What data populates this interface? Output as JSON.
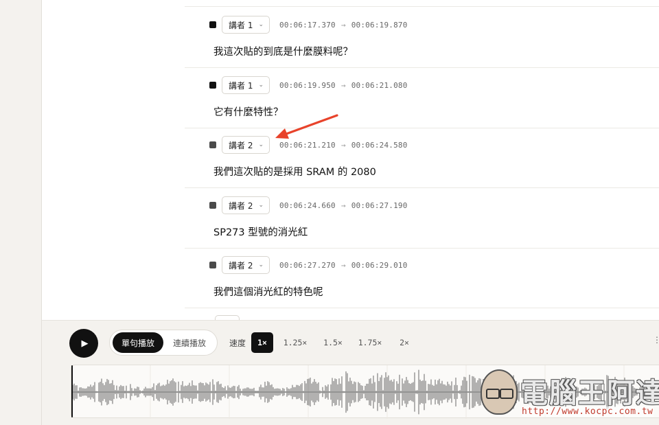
{
  "segments": [
    {
      "speaker": "講者 1",
      "start": "00:06:17.370",
      "arrow": "→",
      "end": "00:06:19.870",
      "text": "我這次貼的到底是什麼膜料呢？",
      "color": "#111111"
    },
    {
      "speaker": "講者 1",
      "start": "00:06:19.950",
      "arrow": "→",
      "end": "00:06:21.080",
      "text": "它有什麼特性？",
      "color": "#111111"
    },
    {
      "speaker": "講者 2",
      "start": "00:06:21.210",
      "arrow": "→",
      "end": "00:06:24.580",
      "text": "我們這次貼的是採用 SRAM 的 2080",
      "color": "#4a4a4a"
    },
    {
      "speaker": "講者 2",
      "start": "00:06:24.660",
      "arrow": "→",
      "end": "00:06:27.190",
      "text": "SP273 型號的消光紅",
      "color": "#4a4a4a"
    },
    {
      "speaker": "講者 2",
      "start": "00:06:27.270",
      "arrow": "→",
      "end": "00:06:29.010",
      "text": "我們這個消光紅的特色呢",
      "color": "#4a4a4a"
    }
  ],
  "player": {
    "play_icon": "play-icon",
    "mode_active": "單句播放",
    "mode_inactive": "連續播放",
    "speed_label": "速度",
    "speeds": [
      "1×",
      "1.25×",
      "1.5×",
      "1.75×",
      "2×"
    ],
    "active_speed": "1×",
    "more_icon": "more-icon",
    "playhead_fraction": 0
  },
  "annotation": {
    "arrow_color": "#e8432b"
  },
  "watermark": {
    "title": "電腦王阿達",
    "url": "http://www.kocpc.com.tw"
  },
  "colors": {
    "accent": "#111111",
    "background": "#f4f2ee",
    "waveform": "#8a8a8a"
  }
}
